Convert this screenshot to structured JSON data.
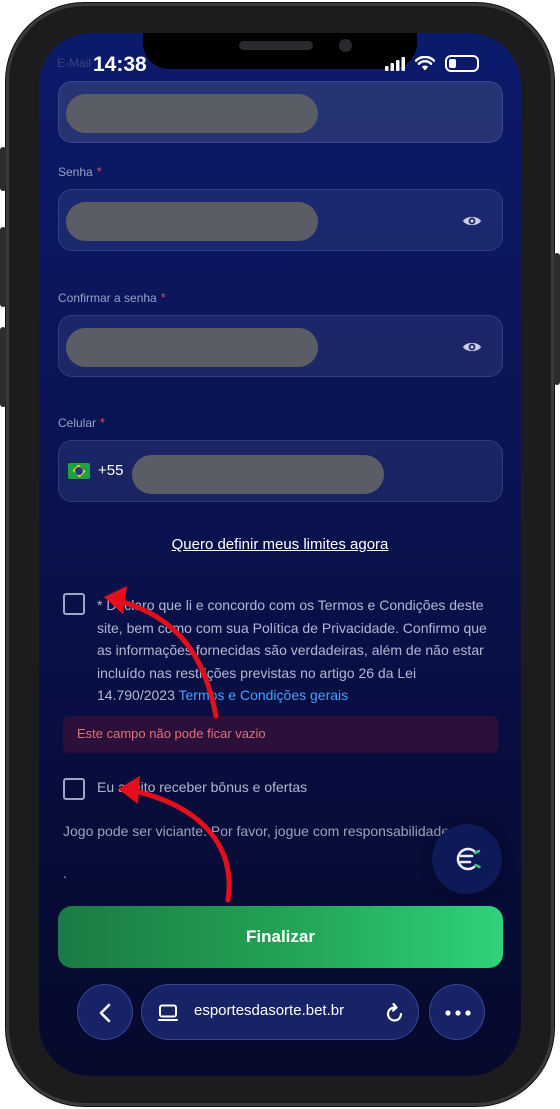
{
  "status_bar": {
    "time": "14:38",
    "faded_label": "E-Mail"
  },
  "form": {
    "password_label": "Senha",
    "confirm_password_label": "Confirmar a senha",
    "phone_label": "Celular",
    "required_marker": "*",
    "phone_prefix": "+55",
    "flag_icon": "brazil-flag-icon"
  },
  "limits_link": "Quero definir meus limites agora",
  "terms": {
    "text": "* Declaro que li e concordo com os Termos e Condições deste site, bem como com sua Política de Privacidade. Confirmo que as informações fornecidas são verdadeiras, além de não estar incluído nas restrições previstas no artigo 26 da Lei 14.790/2023",
    "link": "Termos e Condições gerais"
  },
  "error_message": "Este campo não pode ficar vazio",
  "bonus_text": "Eu aceito receber bônus e ofertas",
  "warning_text": "Jogo pode ser viciante. Por favor, jogue com responsabilidade",
  "trailing_dot": ".",
  "submit_label": "Finalizar",
  "browser": {
    "url": "esportesdasorte.bet.br"
  },
  "colors": {
    "accent_green": "#23a657",
    "error_red": "#e5484d",
    "link_blue": "#4a9eff",
    "annotation_red": "#e3101c",
    "background_navy": "#0a1350"
  }
}
